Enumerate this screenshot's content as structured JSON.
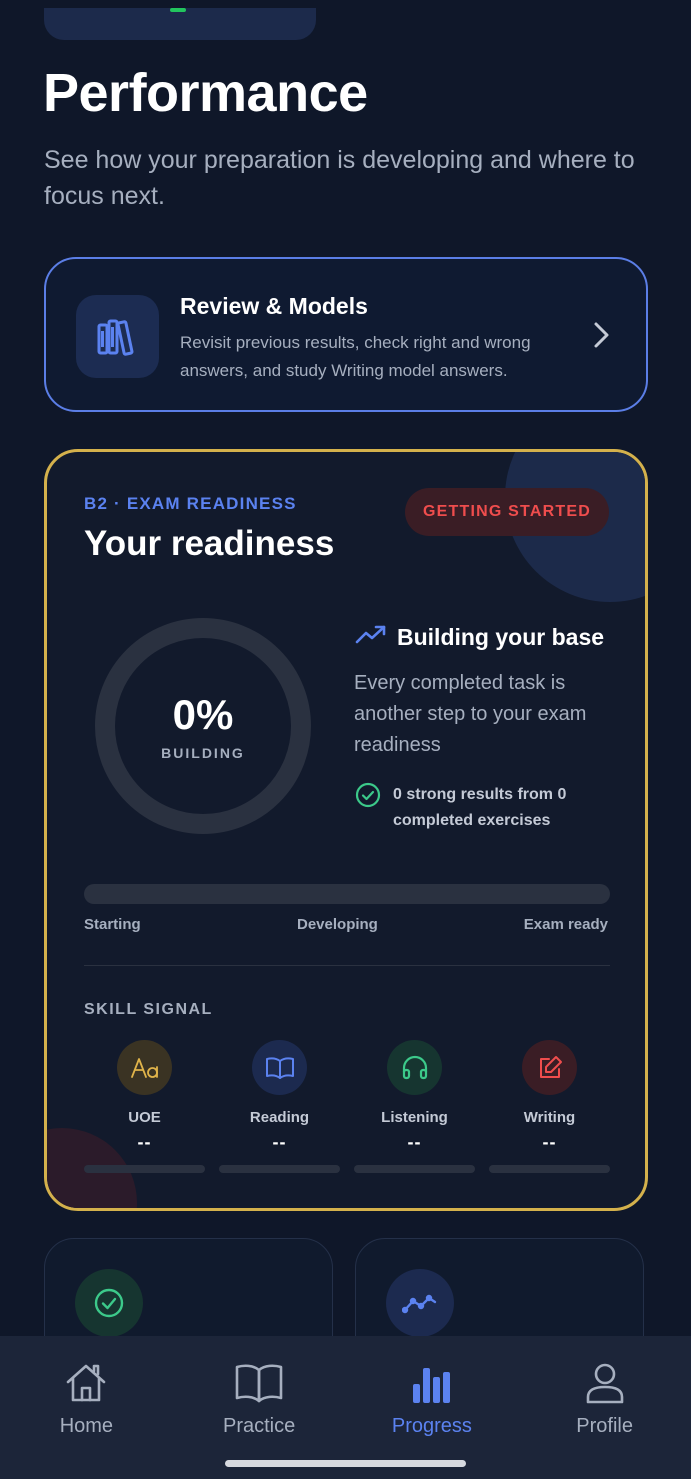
{
  "header": {
    "title": "Performance",
    "subtitle": "See how your preparation is developing and where to focus next."
  },
  "review_card": {
    "title": "Review & Models",
    "description": "Revisit previous results, check right and wrong answers, and study Writing model answers.",
    "icon": "books-icon"
  },
  "readiness": {
    "eyebrow": "B2 · EXAM READINESS",
    "title": "Your readiness",
    "badge": "GETTING STARTED",
    "percent_text": "0%",
    "percent_value": 0,
    "ring_label": "BUILDING",
    "insight_title": "Building your base",
    "insight_desc": "Every completed task is another step to your exam readiness",
    "insight_stat": "0 strong results from 0 completed exercises",
    "progress_value": 0,
    "scale": {
      "start": "Starting",
      "middle": "Developing",
      "end": "Exam ready"
    },
    "skill_heading": "SKILL SIGNAL",
    "skills": [
      {
        "name": "UOE",
        "value": "--",
        "icon": "text-aa-icon",
        "color": "#e0b44a"
      },
      {
        "name": "Reading",
        "value": "--",
        "icon": "open-book-icon",
        "color": "#5b82f0"
      },
      {
        "name": "Listening",
        "value": "--",
        "icon": "headphones-icon",
        "color": "#3cc98a"
      },
      {
        "name": "Writing",
        "value": "--",
        "icon": "edit-icon",
        "color": "#ef4d4d"
      }
    ]
  },
  "nav": {
    "items": [
      {
        "label": "Home",
        "icon": "home-icon",
        "active": false
      },
      {
        "label": "Practice",
        "icon": "book-icon",
        "active": false
      },
      {
        "label": "Progress",
        "icon": "bar-chart-icon",
        "active": true
      },
      {
        "label": "Profile",
        "icon": "user-icon",
        "active": false
      }
    ]
  },
  "colors": {
    "background": "#0f1729",
    "accent_blue": "#5b82f0",
    "accent_gold": "#d4b14c",
    "badge_red": "#ef4d4d",
    "success_green": "#3cc98a"
  }
}
